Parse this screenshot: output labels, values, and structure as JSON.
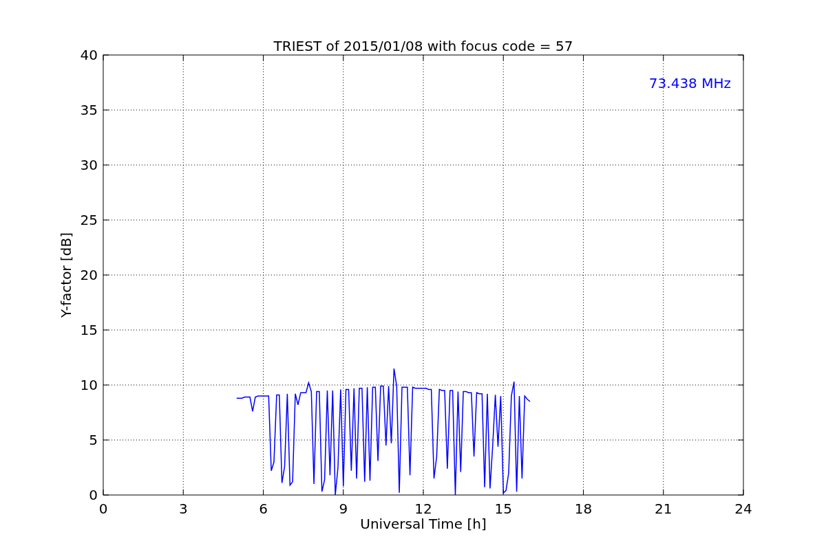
{
  "figure": {
    "chart_data": {
      "type": "line",
      "title": "TRIEST of 2015/01/08 with focus code = 57",
      "xlabel": "Universal Time [h]",
      "ylabel": "Y-factor [dB]",
      "xlim": [
        0,
        24
      ],
      "ylim": [
        0,
        40
      ],
      "xticks": [
        0,
        3,
        6,
        9,
        12,
        15,
        18,
        21,
        24
      ],
      "yticks": [
        0,
        5,
        10,
        15,
        20,
        25,
        30,
        35,
        40
      ],
      "x": [
        5.0,
        5.1,
        5.2,
        5.3,
        5.4,
        5.5,
        5.6,
        5.7,
        5.8,
        5.9,
        6.0,
        6.1,
        6.2,
        6.3,
        6.4,
        6.5,
        6.6,
        6.7,
        6.8,
        6.9,
        7.0,
        7.1,
        7.2,
        7.3,
        7.4,
        7.5,
        7.6,
        7.7,
        7.8,
        7.9,
        8.0,
        8.1,
        8.2,
        8.3,
        8.4,
        8.5,
        8.6,
        8.7,
        8.8,
        8.9,
        9.0,
        9.1,
        9.2,
        9.3,
        9.4,
        9.5,
        9.6,
        9.7,
        9.8,
        9.9,
        10.0,
        10.1,
        10.2,
        10.3,
        10.4,
        10.5,
        10.6,
        10.7,
        10.8,
        10.9,
        11.0,
        11.1,
        11.2,
        11.3,
        11.4,
        11.5,
        11.6,
        11.7,
        11.8,
        11.9,
        12.0,
        12.1,
        12.2,
        12.3,
        12.4,
        12.5,
        12.6,
        12.7,
        12.8,
        12.9,
        13.0,
        13.1,
        13.2,
        13.3,
        13.4,
        13.5,
        13.6,
        13.7,
        13.8,
        13.9,
        14.0,
        14.1,
        14.2,
        14.3,
        14.4,
        14.5,
        14.6,
        14.7,
        14.8,
        14.9,
        15.0,
        15.1,
        15.2,
        15.3,
        15.4,
        15.5,
        15.6,
        15.7,
        15.8,
        15.9,
        16.0
      ],
      "series": [
        {
          "name": "73.438 MHz",
          "color": "#0000ff",
          "values": [
            8.8,
            8.8,
            8.8,
            8.9,
            8.9,
            8.9,
            7.6,
            8.9,
            9.0,
            9.0,
            9.0,
            9.0,
            9.0,
            2.2,
            3.0,
            9.1,
            9.1,
            1.1,
            2.6,
            9.2,
            0.9,
            1.2,
            9.2,
            8.2,
            9.3,
            9.3,
            9.3,
            10.2,
            9.4,
            1.0,
            9.4,
            9.4,
            0.3,
            1.4,
            9.5,
            1.8,
            9.5,
            0.0,
            2.5,
            9.6,
            0.8,
            9.6,
            9.6,
            2.2,
            9.7,
            1.5,
            9.7,
            9.7,
            1.2,
            9.8,
            1.3,
            9.8,
            9.8,
            3.1,
            9.9,
            9.9,
            4.5,
            9.9,
            4.7,
            11.5,
            9.9,
            0.2,
            9.8,
            9.8,
            9.8,
            1.8,
            9.8,
            9.7,
            9.7,
            9.7,
            9.7,
            9.7,
            9.6,
            9.6,
            1.5,
            3.5,
            9.6,
            9.5,
            9.5,
            2.4,
            9.5,
            9.5,
            0.0,
            9.4,
            2.1,
            9.4,
            9.4,
            9.3,
            9.3,
            3.5,
            9.3,
            9.2,
            9.2,
            0.7,
            9.2,
            0.6,
            4.5,
            9.1,
            4.4,
            9.0,
            0.2,
            0.4,
            2.0,
            9.0,
            10.3,
            0.3,
            9.0,
            1.5,
            9.0,
            8.7,
            8.5
          ]
        }
      ],
      "grid": true
    }
  }
}
